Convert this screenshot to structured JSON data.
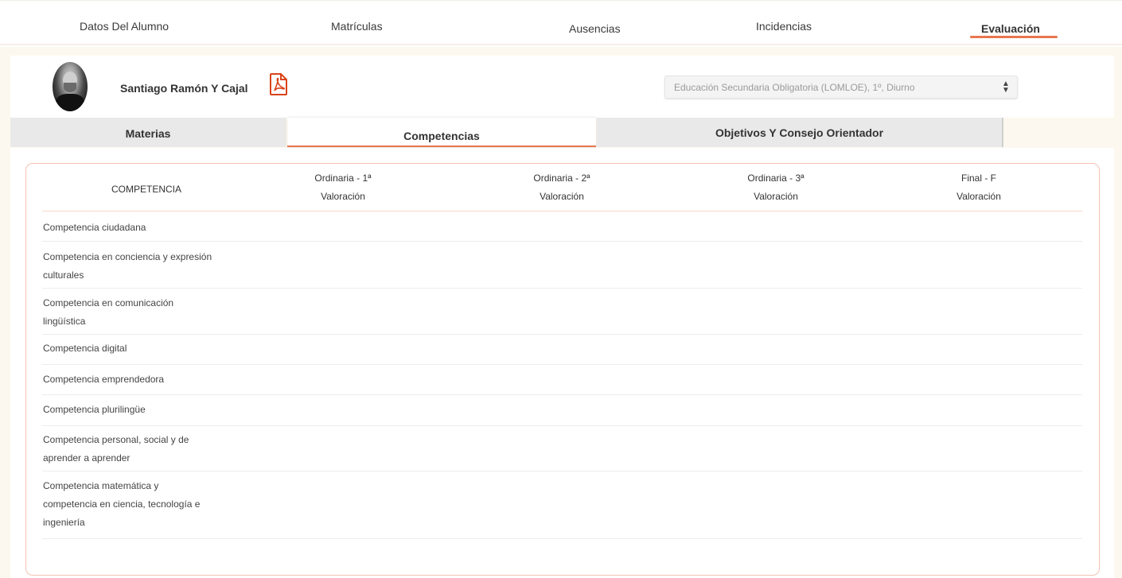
{
  "topnav": {
    "items": [
      {
        "label": "Datos Del Alumno"
      },
      {
        "label": "Matrículas"
      },
      {
        "label": "Ausencias"
      },
      {
        "label": "Incidencias"
      },
      {
        "label": "Evaluación"
      }
    ],
    "active": "Evaluación"
  },
  "student": {
    "name": "Santiago Ramón Y Cajal",
    "pdf_icon": "pdf-file-icon",
    "enrollment_select": "Educación Secundaria Obligatoria (LOMLOE), 1º, Diurno"
  },
  "subtabs": [
    {
      "label": "Materias"
    },
    {
      "label": "Competencias"
    },
    {
      "label": "Objetivos Y Consejo Orientador"
    }
  ],
  "table": {
    "headers": {
      "competencia": "COMPETENCIA",
      "columns": [
        {
          "line1": "Ordinaria - 1ª",
          "line2": "Valoración"
        },
        {
          "line1": "Ordinaria - 2ª",
          "line2": "Valoración"
        },
        {
          "line1": "Ordinaria - 3ª",
          "line2": "Valoración"
        },
        {
          "line1": "Final - F",
          "line2": "Valoración"
        }
      ]
    },
    "rows": [
      {
        "line1": "Competencia ciudadana",
        "line2": "",
        "line3": ""
      },
      {
        "line1": "Competencia en conciencia y expresión",
        "line2": "culturales",
        "line3": ""
      },
      {
        "line1": "Competencia en comunicación",
        "line2": "lingüística",
        "line3": ""
      },
      {
        "line1": "Competencia digital",
        "line2": "",
        "line3": ""
      },
      {
        "line1": "Competencia emprendedora",
        "line2": "",
        "line3": ""
      },
      {
        "line1": "Competencia plurilingüe",
        "line2": "",
        "line3": ""
      },
      {
        "line1": "Competencia personal, social y de",
        "line2": "aprender a aprender",
        "line3": ""
      },
      {
        "line1": "Competencia matemática y",
        "line2": "competencia en ciencia, tecnología e",
        "line3": "ingeniería"
      }
    ]
  },
  "colors": {
    "accent": "#e8764f",
    "background": "#fdf8ef",
    "pdf_red": "#d9441a"
  }
}
